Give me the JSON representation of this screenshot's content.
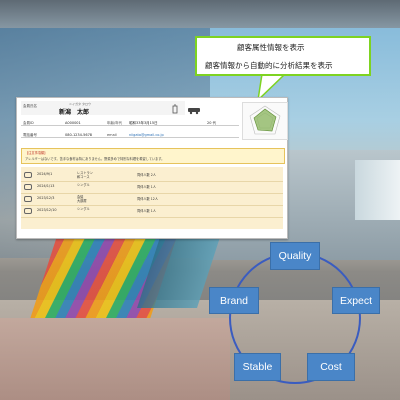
{
  "callout": {
    "line1": "顧客属性情報を表示",
    "line2": "顧客情報から自動的に分析結果を表示",
    "border_color": "#7ed321"
  },
  "card": {
    "name_label": "会員氏名",
    "kana": "ニイガタ タロウ",
    "name": "新潟　太郎",
    "rows": [
      {
        "label": "会員ID",
        "value": "A000001",
        "label2": "年齢/年代",
        "value2": "昭和33年3月15日",
        "label3": "",
        "value3": "",
        "label4": "",
        "value4": "20 代"
      },
      {
        "label": "電話番号",
        "value": "080-1234-5678",
        "label2": "email",
        "value2": "niigata@gmail.co.jp"
      }
    ],
    "alert_title": "【注意事項欄】",
    "alert_text": "アレルギーはないです。苦手な食材は特にありません。野菜多めで特別な料理を希望しています。",
    "history": [
      {
        "date": "2024/9/1",
        "plan": "レストラン\n和コース",
        "count": "同伴人数 2人"
      },
      {
        "date": "2024/1/13",
        "plan": "シングル",
        "count": "同伴人数 1人"
      },
      {
        "date": "2023/12/3",
        "plan": "会議\n大部屋",
        "count": "同伴人数 12人"
      },
      {
        "date": "2023/12/10",
        "plan": "シングル",
        "count": "同伴人数 1人"
      }
    ]
  },
  "cycle": {
    "nodes": [
      {
        "label": "Quality"
      },
      {
        "label": "Expect"
      },
      {
        "label": "Cost"
      },
      {
        "label": "Stable"
      },
      {
        "label": "Brand"
      }
    ],
    "node_color": "#4a86c8",
    "ring_color": "#3a5cc0"
  }
}
